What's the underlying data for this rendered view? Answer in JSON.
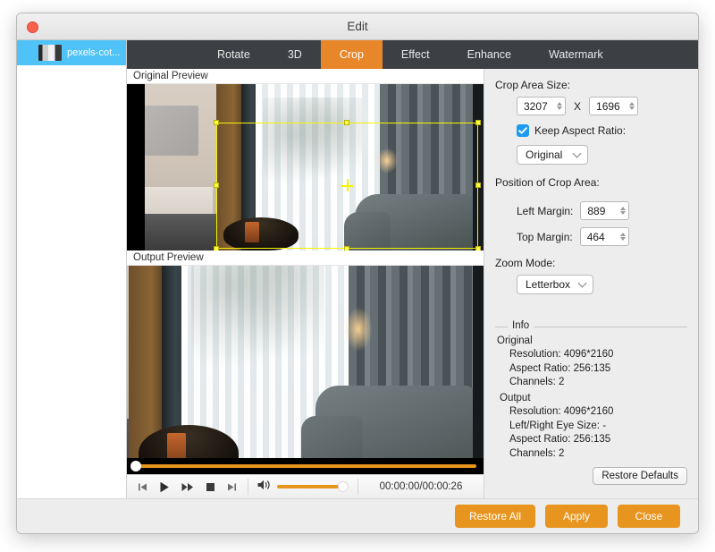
{
  "window": {
    "title": "Edit",
    "close_button": "close"
  },
  "sidebar": {
    "items": [
      {
        "label": "pexels-cot...",
        "thumb": "video-thumbnail"
      }
    ]
  },
  "tabs": [
    {
      "label": "Rotate",
      "active": false
    },
    {
      "label": "3D",
      "active": false
    },
    {
      "label": "Crop",
      "active": true
    },
    {
      "label": "Effect",
      "active": false
    },
    {
      "label": "Enhance",
      "active": false
    },
    {
      "label": "Watermark",
      "active": false
    }
  ],
  "previews": {
    "original_label": "Original Preview",
    "output_label": "Output Preview"
  },
  "transport": {
    "prev_icon": "skip-to-start-icon",
    "play_icon": "play-icon",
    "forward_icon": "fast-forward-icon",
    "stop_icon": "stop-icon",
    "next_icon": "skip-to-end-icon",
    "volume_icon": "volume-icon",
    "time": "00:00:00/00:00:26"
  },
  "panel": {
    "crop_area_size_label": "Crop Area Size:",
    "width_value": "3207",
    "x_separator": "X",
    "height_value": "1696",
    "keep_aspect_ratio_label": "Keep Aspect Ratio:",
    "keep_aspect_ratio_checked": true,
    "aspect_ratio_value": "Original",
    "position_label": "Position of Crop Area:",
    "left_margin_label": "Left Margin:",
    "left_margin_value": "889",
    "top_margin_label": "Top Margin:",
    "top_margin_value": "464",
    "zoom_mode_label": "Zoom Mode:",
    "zoom_mode_value": "Letterbox"
  },
  "info": {
    "title": "Info",
    "original_title": "Original",
    "original_lines": [
      "Resolution: 4096*2160",
      "Aspect Ratio: 256:135",
      "Channels: 2"
    ],
    "output_title": "Output",
    "output_lines": [
      "Resolution: 4096*2160",
      "Left/Right Eye Size: -",
      "Aspect Ratio: 256:135",
      "Channels: 2"
    ],
    "restore_defaults_label": "Restore Defaults"
  },
  "footer": {
    "restore_all_label": "Restore All",
    "apply_label": "Apply",
    "close_label": "Close"
  },
  "colors": {
    "accent_orange": "#e8951f",
    "tab_active": "#e8862a",
    "tabbar_bg": "#3c4045",
    "sidebar_selected": "#4fc3f7",
    "checkbox_blue": "#1e9bf0",
    "crop_outline": "#f5f500"
  }
}
